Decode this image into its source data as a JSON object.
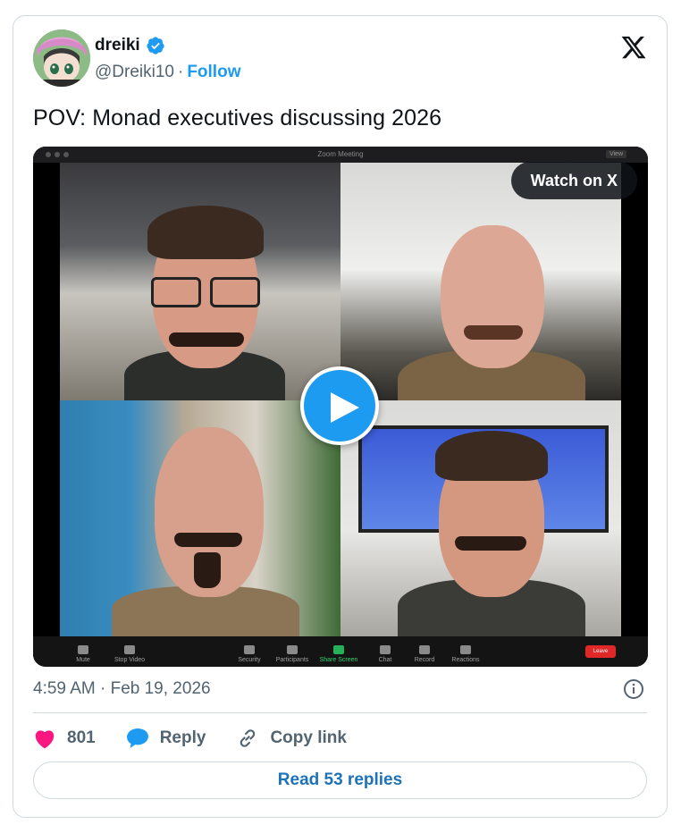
{
  "author": {
    "display_name": "dreiki",
    "handle": "@Dreiki10",
    "separator": "·",
    "follow_label": "Follow"
  },
  "tweet": {
    "text": "POV: Monad executives discussing 2026",
    "timestamp": "4:59 AM · Feb 19, 2026"
  },
  "video": {
    "watch_label": "Watch on X",
    "zoom_window_title": "Zoom Meeting",
    "zoom_view_label": "View",
    "zoom_controls": [
      "Mute",
      "Stop Video",
      "Security",
      "Participants",
      "Share Screen",
      "Chat",
      "Record",
      "Reactions"
    ],
    "zoom_leave_label": "Leave"
  },
  "actions": {
    "like_count": "801",
    "reply_label": "Reply",
    "copy_link_label": "Copy link"
  },
  "read_replies_label": "Read 53 replies",
  "colors": {
    "brand_blue": "#1d9bf0",
    "like_pink": "#f91880",
    "text_secondary": "#536471",
    "border": "#cfd9de"
  },
  "icons": [
    "verified-badge-icon",
    "x-logo-icon",
    "play-icon",
    "info-icon",
    "heart-icon",
    "reply-bubble-icon",
    "link-icon"
  ]
}
